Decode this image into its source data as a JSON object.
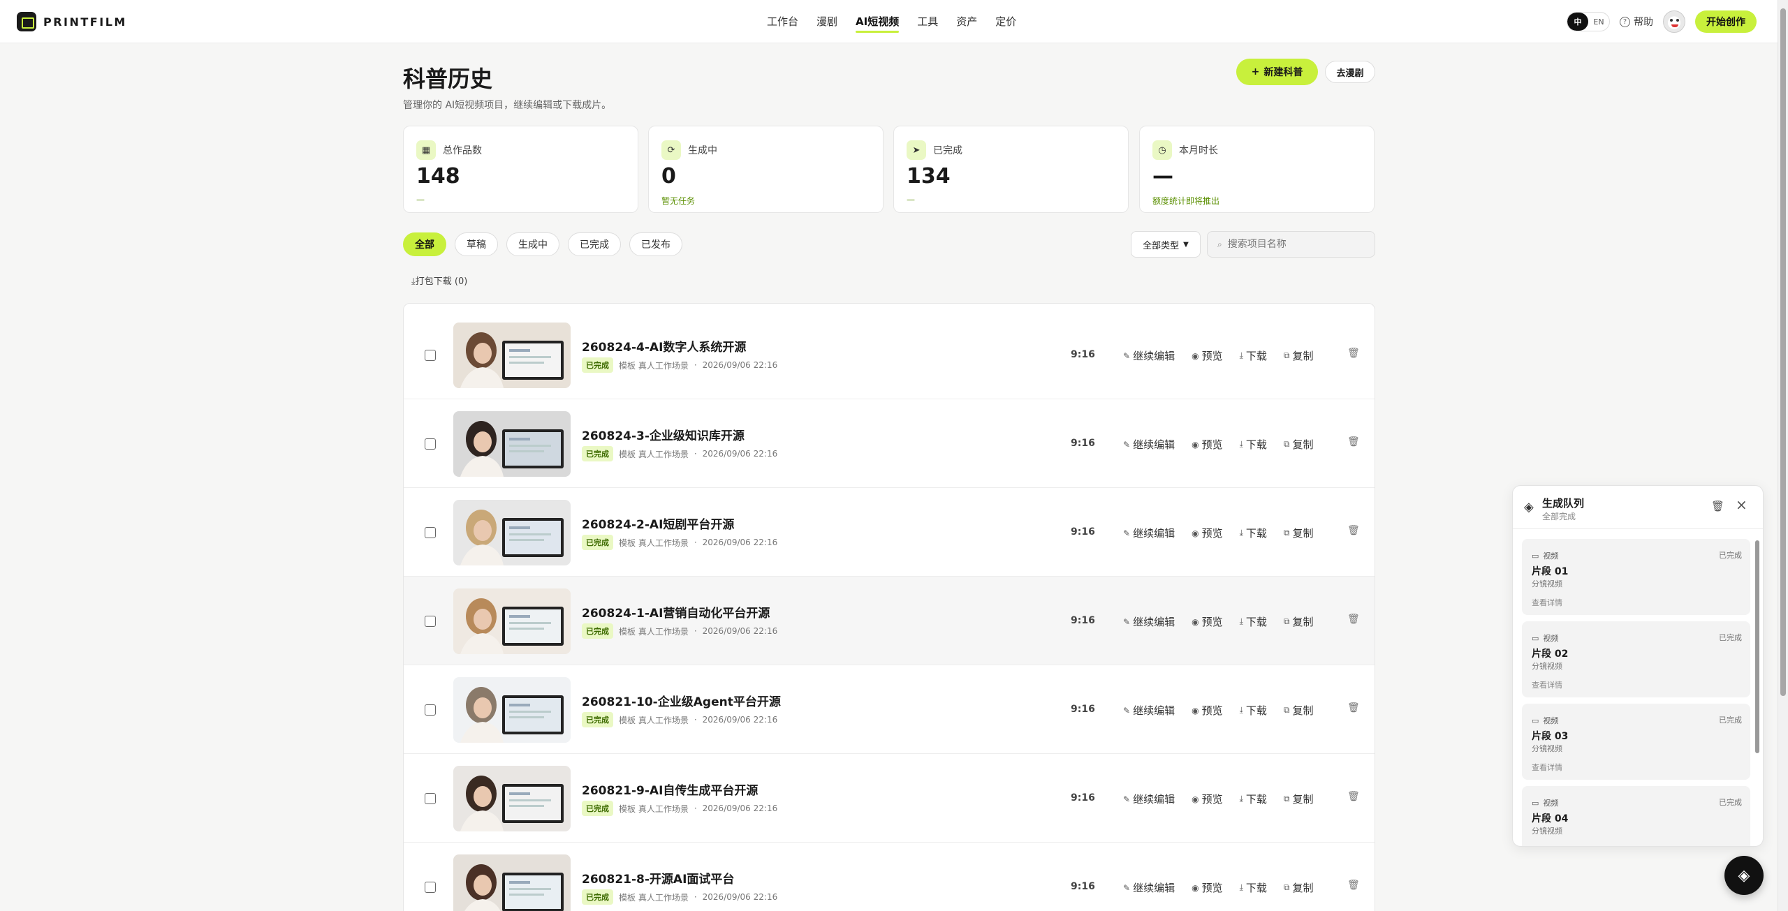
{
  "brand": {
    "name": "PRINTFILM"
  },
  "nav": [
    {
      "label": "工作台"
    },
    {
      "label": "漫剧"
    },
    {
      "label": "AI短视频"
    },
    {
      "label": "工具"
    },
    {
      "label": "资产"
    },
    {
      "label": "定价"
    }
  ],
  "topbar": {
    "lang_zh": "中",
    "lang_en": "EN",
    "help": "帮助",
    "cta": "开始创作"
  },
  "page": {
    "title": "科普历史",
    "subtitle": "管理你的 AI短视频项目，继续编辑或下载成片。",
    "new_button": "新建科普",
    "go_button": "去漫剧"
  },
  "stats": [
    {
      "label": "总作品数",
      "value": "148",
      "note": "—",
      "icon": "calendar-icon"
    },
    {
      "label": "生成中",
      "value": "0",
      "note": "暂无任务",
      "icon": "refresh-icon"
    },
    {
      "label": "已完成",
      "value": "134",
      "note": "—",
      "icon": "send-icon"
    },
    {
      "label": "本月时长",
      "value": "—",
      "note": "额度统计即将推出",
      "icon": "clock-icon"
    }
  ],
  "filters": {
    "chips": [
      {
        "label": "全部"
      },
      {
        "label": "草稿"
      },
      {
        "label": "生成中"
      },
      {
        "label": "已完成"
      },
      {
        "label": "已发布"
      }
    ],
    "type_select": "全部类型",
    "search_placeholder": "搜索项目名称",
    "bulk_download": "打包下载 (0)"
  },
  "row_actions": {
    "edit": "继续编辑",
    "preview": "预览",
    "download": "下载",
    "copy": "复制"
  },
  "projects": [
    {
      "title": "260824-4-AI数字人系统开源",
      "status": "已完成",
      "template": "模板 真人工作场景",
      "time": "2026/09/06 22:16",
      "ratio": "9:16"
    },
    {
      "title": "260824-3-企业级知识库开源",
      "status": "已完成",
      "template": "模板 真人工作场景",
      "time": "2026/09/06 22:16",
      "ratio": "9:16"
    },
    {
      "title": "260824-2-AI短剧平台开源",
      "status": "已完成",
      "template": "模板 真人工作场景",
      "time": "2026/09/06 22:16",
      "ratio": "9:16"
    },
    {
      "title": "260824-1-AI营销自动化平台开源",
      "status": "已完成",
      "template": "模板 真人工作场景",
      "time": "2026/09/06 22:16",
      "ratio": "9:16"
    },
    {
      "title": "260821-10-企业级Agent平台开源",
      "status": "已完成",
      "template": "模板 真人工作场景",
      "time": "2026/09/06 22:16",
      "ratio": "9:16"
    },
    {
      "title": "260821-9-AI自传生成平台开源",
      "status": "已完成",
      "template": "模板 真人工作场景",
      "time": "2026/09/06 22:16",
      "ratio": "9:16"
    },
    {
      "title": "260821-8-开源AI面试平台",
      "status": "已完成",
      "template": "模板 真人工作场景",
      "time": "2026/09/06 22:16",
      "ratio": "9:16"
    }
  ],
  "queue": {
    "title": "生成队列",
    "subtitle": "全部完成",
    "items": [
      {
        "kind": "视频",
        "status": "已完成",
        "name": "片段 01",
        "desc": "分镜视频",
        "link": "查看详情"
      },
      {
        "kind": "视频",
        "status": "已完成",
        "name": "片段 02",
        "desc": "分镜视频",
        "link": "查看详情"
      },
      {
        "kind": "视频",
        "status": "已完成",
        "name": "片段 03",
        "desc": "分镜视频",
        "link": "查看详情"
      },
      {
        "kind": "视频",
        "status": "已完成",
        "name": "片段 04",
        "desc": "分镜视频",
        "link": ""
      }
    ]
  },
  "colors": {
    "accent": "#c8f03c",
    "accent_soft": "#eaf8c4",
    "text": "#1a1a1a"
  }
}
